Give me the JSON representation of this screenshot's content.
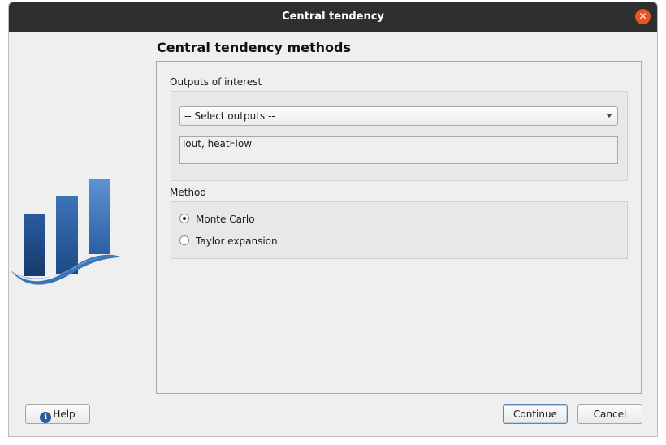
{
  "window": {
    "title": "Central tendency"
  },
  "page": {
    "heading": "Central tendency methods"
  },
  "outputs": {
    "label": "Outputs of interest",
    "combo_value": "-- Select outputs --",
    "selected_text": "Tout, heatFlow"
  },
  "method": {
    "label": "Method",
    "options": [
      {
        "label": "Monte Carlo",
        "checked": true
      },
      {
        "label": "Taylor expansion",
        "checked": false
      }
    ]
  },
  "buttons": {
    "help": "Help",
    "continue": "Continue",
    "cancel": "Cancel"
  },
  "icons": {
    "close": "close-icon",
    "help": "info-icon",
    "logo": "chart-logo-icon"
  },
  "colors": {
    "titlebar": "#2f2f2f",
    "close": "#e95420",
    "logo_blue": "#1f4e8c"
  }
}
